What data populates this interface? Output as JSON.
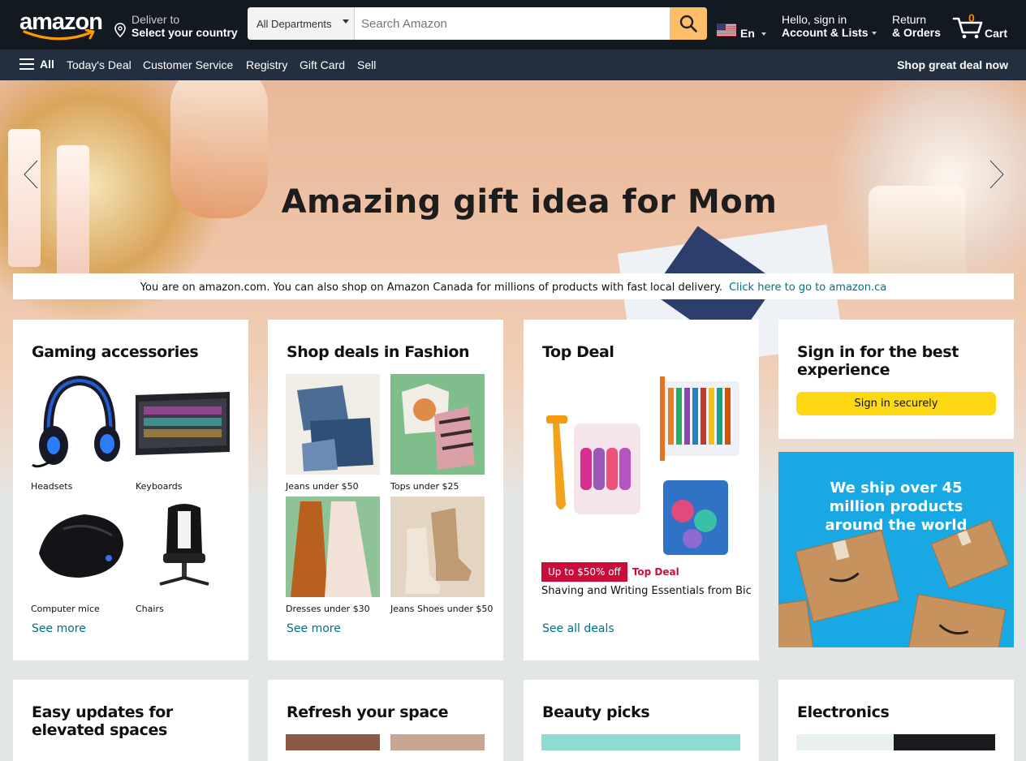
{
  "header": {
    "logo_text": "amazon",
    "deliver_line1": "Deliver to",
    "deliver_line2": "Select your country",
    "search_department": "All Departments",
    "search_placeholder": "Search Amazon",
    "language": "En",
    "account_line1": "Hello, sign in",
    "account_line2": "Account & Lists",
    "returns_line1": "Return",
    "returns_line2": "& Orders",
    "cart_count": "0",
    "cart_label": "Cart"
  },
  "subnav": {
    "all_label": "All",
    "items": [
      "Today's Deal",
      "Customer Service",
      "Registry",
      "Gift Card",
      "Sell"
    ],
    "promo": "Shop great deal now"
  },
  "hero": {
    "headline": "Amazing gift idea for Mom"
  },
  "notice": {
    "text": "You are on amazon.com. You can also shop on Amazon Canada for millions of products with fast local delivery.",
    "link": "Click here to go to amazon.ca"
  },
  "cards": {
    "gaming": {
      "title": "Gaming accessories",
      "tiles": [
        "Headsets",
        "Keyboards",
        "Computer mice",
        "Chairs"
      ],
      "see_more": "See more"
    },
    "fashion": {
      "title": "Shop deals in Fashion",
      "tiles": [
        "Jeans under $50",
        "Tops under $25",
        "Dresses under $30",
        "Jeans Shoes under $50"
      ],
      "see_more": "See more"
    },
    "deal": {
      "title": "Top Deal",
      "badge": "Up to $50% off",
      "badge_label": "Top Deal",
      "description": "Shaving and Writing Essentials from Bic",
      "see_all": "See all deals"
    },
    "signin": {
      "title": "Sign in for the best experience",
      "button": "Sign in securely"
    },
    "ship": {
      "text": "We ship over 45 million products around the world"
    },
    "row2": [
      "Easy updates for elevated spaces",
      "Refresh your space",
      "Beauty picks",
      "Electronics"
    ]
  },
  "colors": {
    "nav_dark": "#131921",
    "nav_sub": "#232f3e",
    "search_button": "#febd69",
    "link": "#007185",
    "deal_red": "#cc0c39",
    "signin_yellow": "#ffd814",
    "cart_count": "#f08804"
  }
}
